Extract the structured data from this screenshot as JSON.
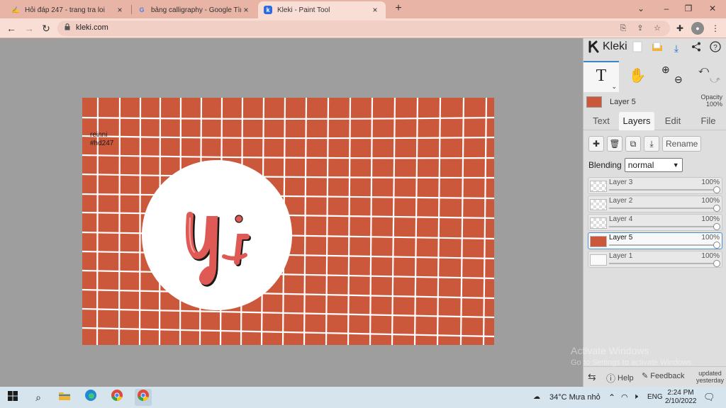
{
  "browser": {
    "tabs": [
      {
        "title": "Hỏi đáp 247 - trang tra loi",
        "active": false,
        "favicon": "hoidap-favicon"
      },
      {
        "title": "bảng calligraphy - Google Tìm kiếm",
        "active": false,
        "favicon": "google-favicon"
      },
      {
        "title": "Kleki - Paint Tool",
        "active": true,
        "favicon": "kleki-favicon"
      }
    ],
    "url": "kleki.com"
  },
  "canvas": {
    "bg_color": "#cc583b",
    "text_lines": [
      "reinni",
      "#hd247"
    ],
    "lettering": "Uyi"
  },
  "kleki": {
    "brand": "Kleki",
    "current_layer": "Layer 5",
    "opacity_label": "Opacity",
    "opacity_value": "100%",
    "tabs": [
      "Text",
      "Layers",
      "Edit",
      "File"
    ],
    "selected_tab": "Layers",
    "rename_label": "Rename",
    "blending_label": "Blending",
    "blending_value": "normal",
    "layers": [
      {
        "name": "Layer 3",
        "opacity": "100%",
        "selected": false
      },
      {
        "name": "Layer 2",
        "opacity": "100%",
        "selected": false
      },
      {
        "name": "Layer 4",
        "opacity": "100%",
        "selected": false
      },
      {
        "name": "Layer 5",
        "opacity": "100%",
        "selected": true
      },
      {
        "name": "Layer 1",
        "opacity": "100%",
        "selected": false
      }
    ],
    "help_label": "Help",
    "feedback_label": "Feedback",
    "updated_line1": "updated",
    "updated_line2": "yesterday"
  },
  "watermark": {
    "line1": "Activate Windows",
    "line2": "Go to Settings to activate Windows."
  },
  "taskbar": {
    "weather": "34°C  Mưa nhỏ",
    "language": "ENG",
    "time": "2:24 PM",
    "date": "2/10/2022"
  }
}
